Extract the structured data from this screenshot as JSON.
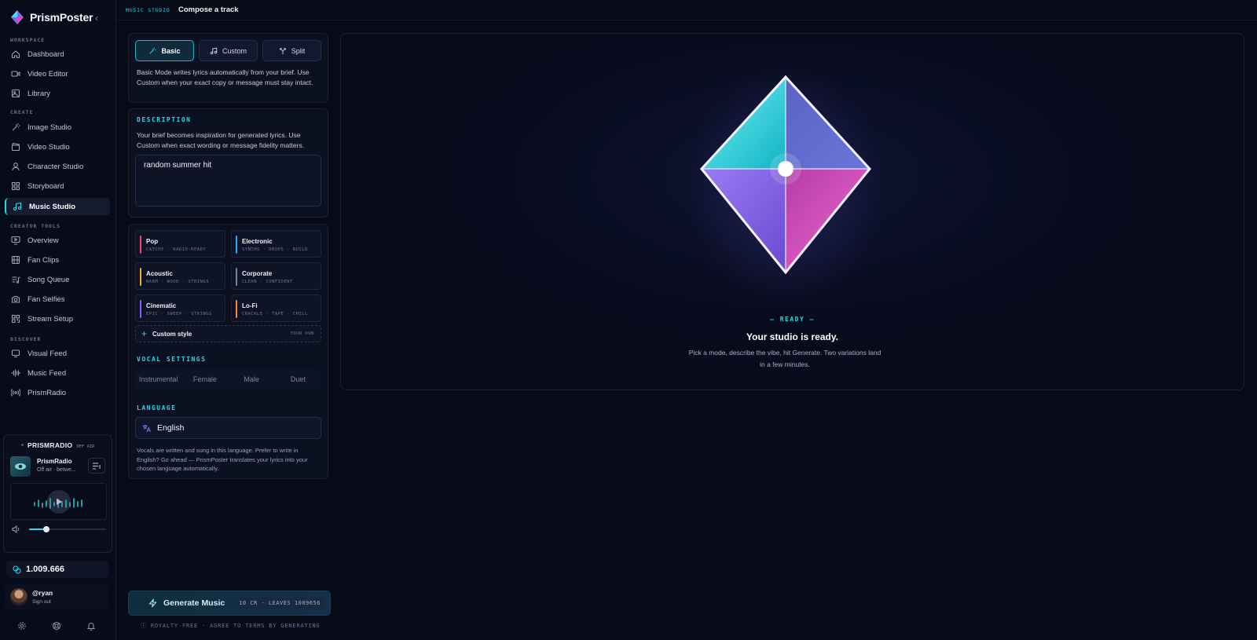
{
  "brand": {
    "name": "PrismPoster"
  },
  "sidebar": {
    "sections": [
      {
        "label": "WORKSPACE",
        "items": [
          {
            "label": "Dashboard",
            "icon": "home-icon"
          },
          {
            "label": "Video Editor",
            "icon": "video-camera-icon"
          },
          {
            "label": "Library",
            "icon": "image-icon"
          }
        ]
      },
      {
        "label": "CREATE",
        "items": [
          {
            "label": "Image Studio",
            "icon": "magic-wand-icon"
          },
          {
            "label": "Video Studio",
            "icon": "clapperboard-icon"
          },
          {
            "label": "Character Studio",
            "icon": "user-icon"
          },
          {
            "label": "Storyboard",
            "icon": "grid-icon"
          },
          {
            "label": "Music Studio",
            "icon": "music-note-icon",
            "active": true
          }
        ]
      },
      {
        "label": "CREATOR TOOLS",
        "items": [
          {
            "label": "Overview",
            "icon": "monitor-play-icon"
          },
          {
            "label": "Fan Clips",
            "icon": "film-icon"
          },
          {
            "label": "Song Queue",
            "icon": "list-music-icon"
          },
          {
            "label": "Fan Selfies",
            "icon": "camera-icon"
          },
          {
            "label": "Stream Setup",
            "icon": "qr-code-icon"
          }
        ]
      },
      {
        "label": "DISCOVER",
        "items": [
          {
            "label": "Visual Feed",
            "icon": "screen-icon"
          },
          {
            "label": "Music Feed",
            "icon": "waveform-icon"
          },
          {
            "label": "PrismRadio",
            "icon": "radio-broadcast-icon"
          }
        ]
      }
    ]
  },
  "radio": {
    "title": "PRISMRADIO",
    "status": "OFF AIR",
    "station": "PrismRadio",
    "subtitle": "Off air · betwe...",
    "volume": 0.22
  },
  "credits": {
    "amount": "1.009.666"
  },
  "user": {
    "handle": "@ryan",
    "action": "Sign out"
  },
  "header": {
    "tag": "MUSIC STUDIO",
    "title": "Compose a track"
  },
  "modes": {
    "items": [
      {
        "label": "Basic",
        "icon": "magic-wand-icon",
        "active": true
      },
      {
        "label": "Custom",
        "icon": "music-note-icon"
      },
      {
        "label": "Split",
        "icon": "split-icon"
      }
    ],
    "description": "Basic Mode writes lyrics automatically from your brief. Use Custom when your exact copy or message must stay intact."
  },
  "description": {
    "label": "DESCRIPTION",
    "help": "Your brief becomes inspiration for generated lyrics. Use Custom when exact wording or message fidelity matters.",
    "value": "random summer hit"
  },
  "styles": {
    "items": [
      {
        "name": "Pop",
        "tags": "CATCHY · RADIO-READY",
        "color": "#ff3d6e"
      },
      {
        "name": "Electronic",
        "tags": "SYNTHS · DROPS · BUILD",
        "color": "#2aa8ff"
      },
      {
        "name": "Acoustic",
        "tags": "WARM · WOOD · STRINGS",
        "color": "#ffa928"
      },
      {
        "name": "Corporate",
        "tags": "CLEAN · CONFIDENT",
        "color": "#7c8296"
      },
      {
        "name": "Cinematic",
        "tags": "EPIC · SWEEP · STRINGS",
        "color": "#8a5cff"
      },
      {
        "name": "Lo-Fi",
        "tags": "CRACKLE · TAPE · CHILL",
        "color": "#ff8a2a"
      }
    ],
    "custom_label": "Custom style",
    "custom_tag": "YOUR OWN"
  },
  "vocal": {
    "label": "VOCAL SETTINGS",
    "options": [
      "Instrumental",
      "Female",
      "Male",
      "Duet"
    ]
  },
  "language": {
    "label": "LANGUAGE",
    "value": "English",
    "help": "Vocals are written and sung in this language. Prefer to write in English? Go ahead — PrismPoster translates your lyrics into your chosen language automatically."
  },
  "generate": {
    "label": "Generate Music",
    "cost": "10 CR · LEAVES 1009656",
    "footnote": "ROYALTY-FREE · AGREE TO TERMS BY GENERATING"
  },
  "preview": {
    "status": "READY",
    "title": "Your studio is ready.",
    "description": "Pick a mode, describe the vibe, hit Generate. Two variations land in a few minutes."
  },
  "colors": {
    "accent": "#2ad8e6",
    "background": "#070a17"
  }
}
